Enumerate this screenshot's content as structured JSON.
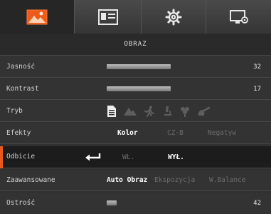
{
  "tabs": [
    {
      "icon": "image-icon",
      "active": true
    },
    {
      "icon": "presentation-icon",
      "active": false
    },
    {
      "icon": "gear-icon",
      "active": false
    },
    {
      "icon": "monitor-settings-icon",
      "active": false
    }
  ],
  "header": {
    "title": "OBRAZ"
  },
  "rows": {
    "brightness": {
      "label": "Jasność",
      "value": "32"
    },
    "contrast": {
      "label": "Kontrast",
      "value": "17"
    },
    "mode": {
      "label": "Tryb",
      "icons": [
        "document-icon",
        "mountain-icon",
        "runner-icon",
        "microscope-icon",
        "flower-icon",
        "flask-icon"
      ]
    },
    "effects": {
      "label": "Efekty",
      "options": [
        "Kolor",
        "CZ-B",
        "Negatyw"
      ],
      "selected": "Kolor"
    },
    "flip": {
      "label": "Odbicie",
      "options": [
        "WŁ.",
        "WYŁ."
      ],
      "selected": "WYŁ."
    },
    "advanced": {
      "label": "Zaawansowane",
      "options": [
        "Auto Obraz",
        "Ekspozycja",
        "W.Balance"
      ],
      "selected": "Auto Obraz"
    },
    "sharpness": {
      "label": "Ostrość",
      "value": "42"
    }
  },
  "levels": {
    "brightness": 0.32,
    "contrast": 0.17,
    "sharpness": 0.42
  },
  "colors": {
    "accent": "#e85a1b",
    "background": "#303030",
    "selected_row": "#1c1c1c",
    "disabled_text": "#6c6c6c"
  }
}
